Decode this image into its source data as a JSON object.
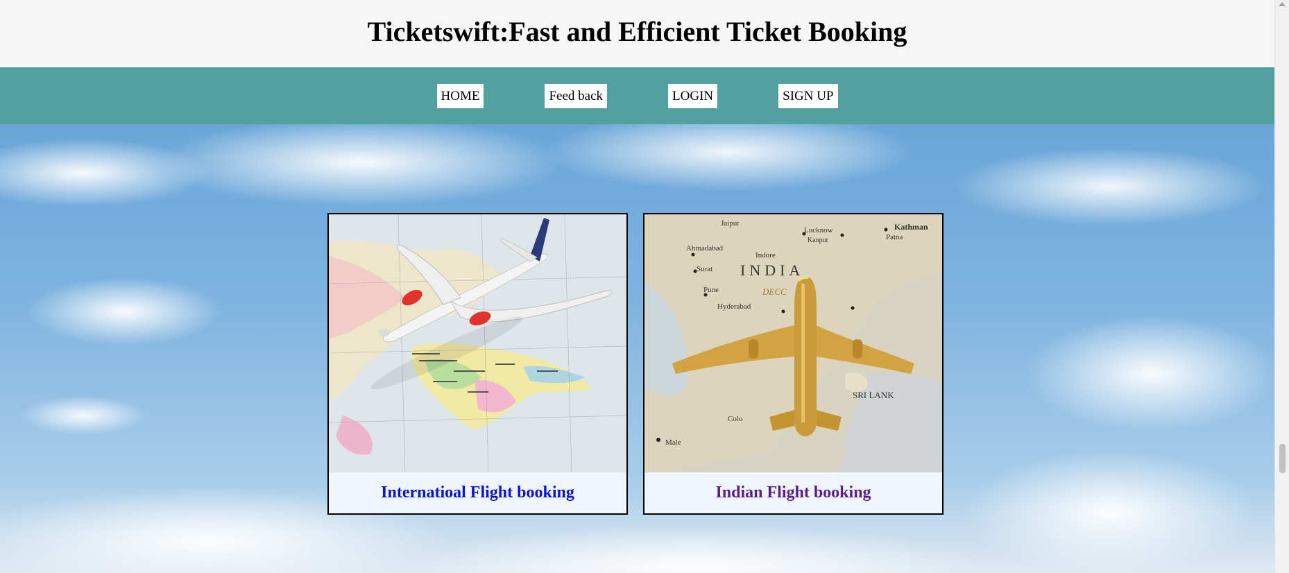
{
  "header": {
    "title": "Ticketswift:Fast and Efficient Ticket Booking"
  },
  "nav": {
    "items": [
      {
        "label": "HOME"
      },
      {
        "label": "Feed back"
      },
      {
        "label": "LOGIN"
      },
      {
        "label": "SIGN UP"
      }
    ]
  },
  "cards": [
    {
      "label": "Internatioal Flight booking",
      "image": "world-map-airplane-image",
      "color": "#0a10d8"
    },
    {
      "label": "Indian Flight booking",
      "image": "india-map-gold-airplane-image",
      "color": "#5a1f86",
      "map_text": [
        "Jaipur",
        "Lucknow",
        "Kanpur",
        "Patna",
        "Kathman",
        "Ahmadabad",
        "Indore",
        "INDIA",
        "Surat",
        "Pune",
        "Hyderabad",
        "DECC",
        "SRI LANK",
        "Colo",
        "Male"
      ]
    }
  ],
  "colors": {
    "nav_bg": "#52a1a1",
    "page_bg": "#f6f6f6"
  }
}
